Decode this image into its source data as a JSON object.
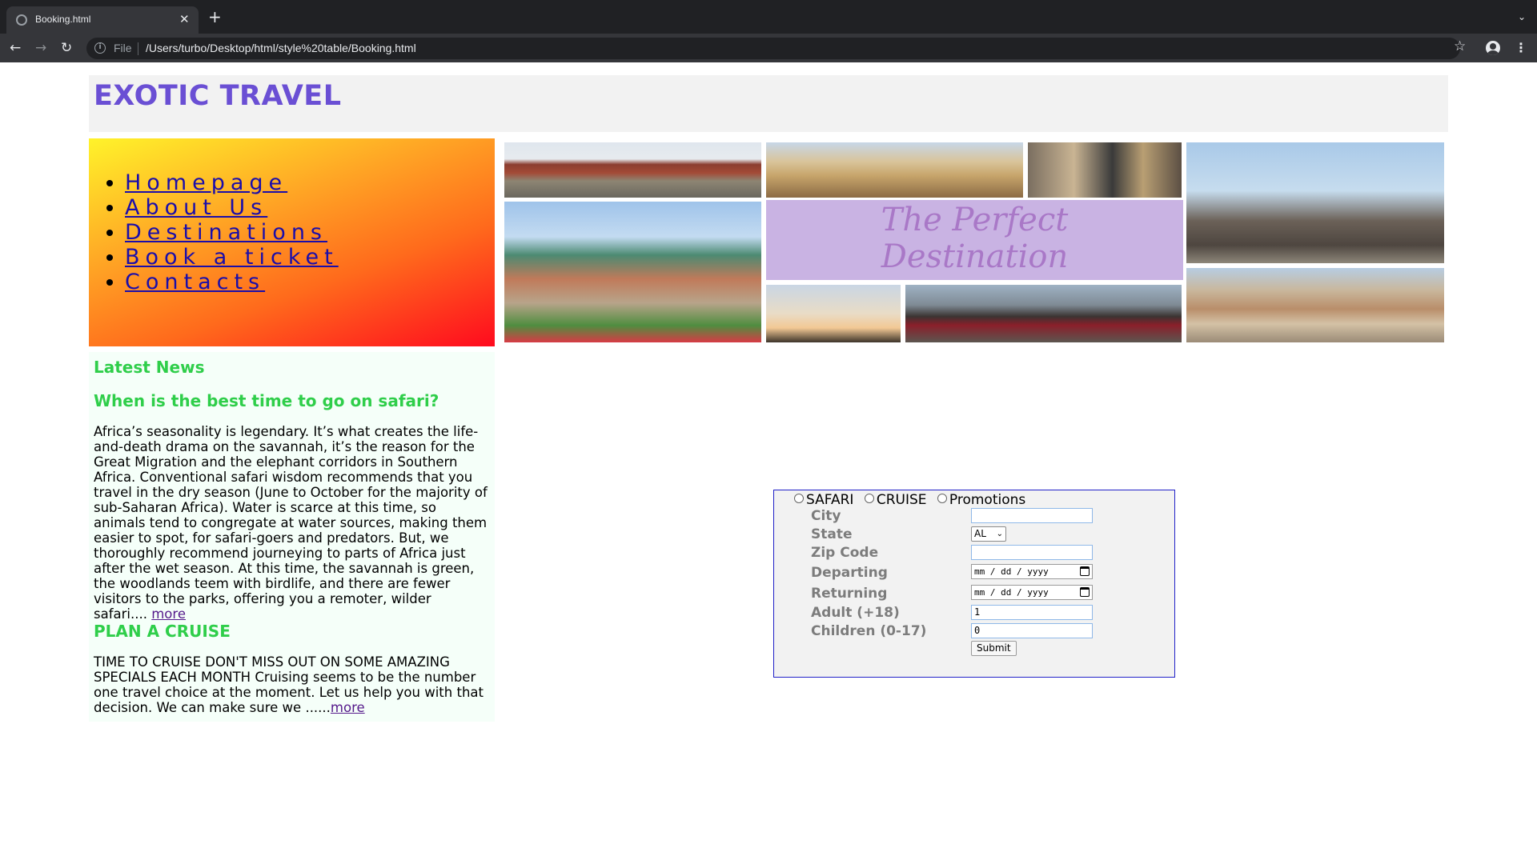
{
  "browser": {
    "tab_title": "Booking.html",
    "scheme_label": "File",
    "url": "/Users/turbo/Desktop/html/style%20table/Booking.html"
  },
  "site": {
    "title": "EXOTIC TRAVEL"
  },
  "nav": {
    "items": [
      {
        "label": "Homepage"
      },
      {
        "label": "About Us"
      },
      {
        "label": "Destinations"
      },
      {
        "label": "Book a ticket"
      },
      {
        "label": "Contacts"
      }
    ]
  },
  "banner": {
    "tagline_line1": "The Perfect",
    "tagline_line2": "Destination"
  },
  "news": {
    "heading": "Latest News",
    "article1": {
      "title": "When is the best time to go on safari?",
      "body": "Africa’s seasonality is legendary. It’s what creates the life-and-death drama on the savannah, it’s the reason for the Great Migration and the elephant corridors in Southern Africa. Conventional safari wisdom recommends that you travel in the dry season (June to October for the majority of sub-Saharan Africa). Water is scarce at this time, so animals tend to congregate at water sources, making them easier to spot, for safari-goers and predators. But, we thoroughly recommend journeying to parts of Africa just after the wet season. At this time, the savannah is green, the woodlands teem with birdlife, and there are fewer visitors to the parks, offering you a remoter, wilder safari.... ",
      "more": "more"
    },
    "article2": {
      "title": "PLAN A CRUISE",
      "body": "TIME TO CRUISE DON'T MISS OUT ON SOME AMAZING SPECIALS EACH MONTH Cruising seems to be the number one travel choice at the moment. Let us help you with that decision. We can make sure we ......",
      "more": "more"
    }
  },
  "booking": {
    "radios": [
      "SAFARI",
      "CRUISE",
      "Promotions"
    ],
    "labels": {
      "city": "City",
      "state": "State",
      "zip": "Zip Code",
      "departing": "Departing",
      "returning": "Returning",
      "adult": "Adult (+18)",
      "children": "Children (0-17)"
    },
    "values": {
      "city": "",
      "state": "AL",
      "zip": "",
      "departing": "mm / dd / yyyy",
      "returning": "mm / dd / yyyy",
      "adult": "1",
      "children": "0"
    },
    "submit": "Submit"
  }
}
